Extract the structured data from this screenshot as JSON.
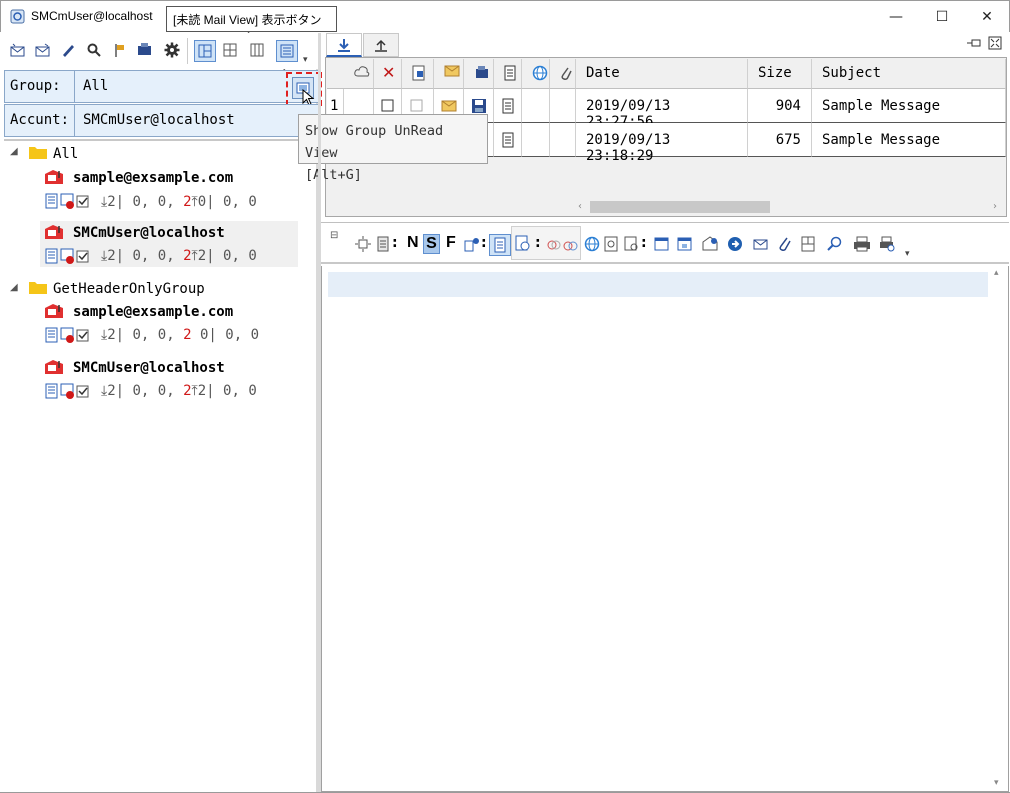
{
  "window": {
    "title": "SMCmUser@localhost",
    "minimize": "—",
    "maximize": "☐",
    "close": "✕"
  },
  "callout": {
    "text": "[未読 Mail View] 表示ボタン"
  },
  "left": {
    "group_label": "Group:",
    "group_value": "All",
    "account_label": "Accunt:",
    "account_value": "SMCmUser@localhost"
  },
  "tree": {
    "groups": [
      {
        "name": "All",
        "accounts": [
          {
            "name": "sample@exsample.com",
            "stats": {
              "recv": "2",
              "a": "0,",
              "b": "0,",
              "c": "2",
              "send": "0",
              "d": "0,",
              "e": "0"
            }
          },
          {
            "name": "SMCmUser@localhost",
            "stats": {
              "recv": "2",
              "a": "0,",
              "b": "0,",
              "c": "2",
              "send": "2",
              "d": "0,",
              "e": "0"
            }
          }
        ]
      },
      {
        "name": "GetHeaderOnlyGroup",
        "accounts": [
          {
            "name": "sample@exsample.com",
            "stats": {
              "recv": "2",
              "a": "0,",
              "b": "0,",
              "c": "2",
              "send": "0",
              "d": "0,",
              "e": "0"
            }
          },
          {
            "name": "SMCmUser@localhost",
            "stats": {
              "recv": "2",
              "a": "0,",
              "b": "0,",
              "c": "2",
              "send": "2",
              "d": "0,",
              "e": "0"
            }
          }
        ]
      }
    ]
  },
  "tooltip": {
    "line1": "Show Group UnRead View",
    "line2": "[Alt+G]"
  },
  "grid": {
    "columns": {
      "date": "Date",
      "size": "Size",
      "subject": "Subject"
    },
    "rows": [
      {
        "num": "1",
        "date": "2019/09/13 23:27:56",
        "size": "904",
        "subject": "Sample Message"
      },
      {
        "num": "",
        "date": "2019/09/13 23:18:29",
        "size": "675",
        "subject": "Sample Message"
      }
    ]
  },
  "preview_toolbar": {
    "n": "N",
    "s": "S",
    "f": "F"
  },
  "colors": {
    "accent": "#2b5fb4",
    "selection": "#e5f0fb",
    "highlight_red": "#d01818"
  }
}
